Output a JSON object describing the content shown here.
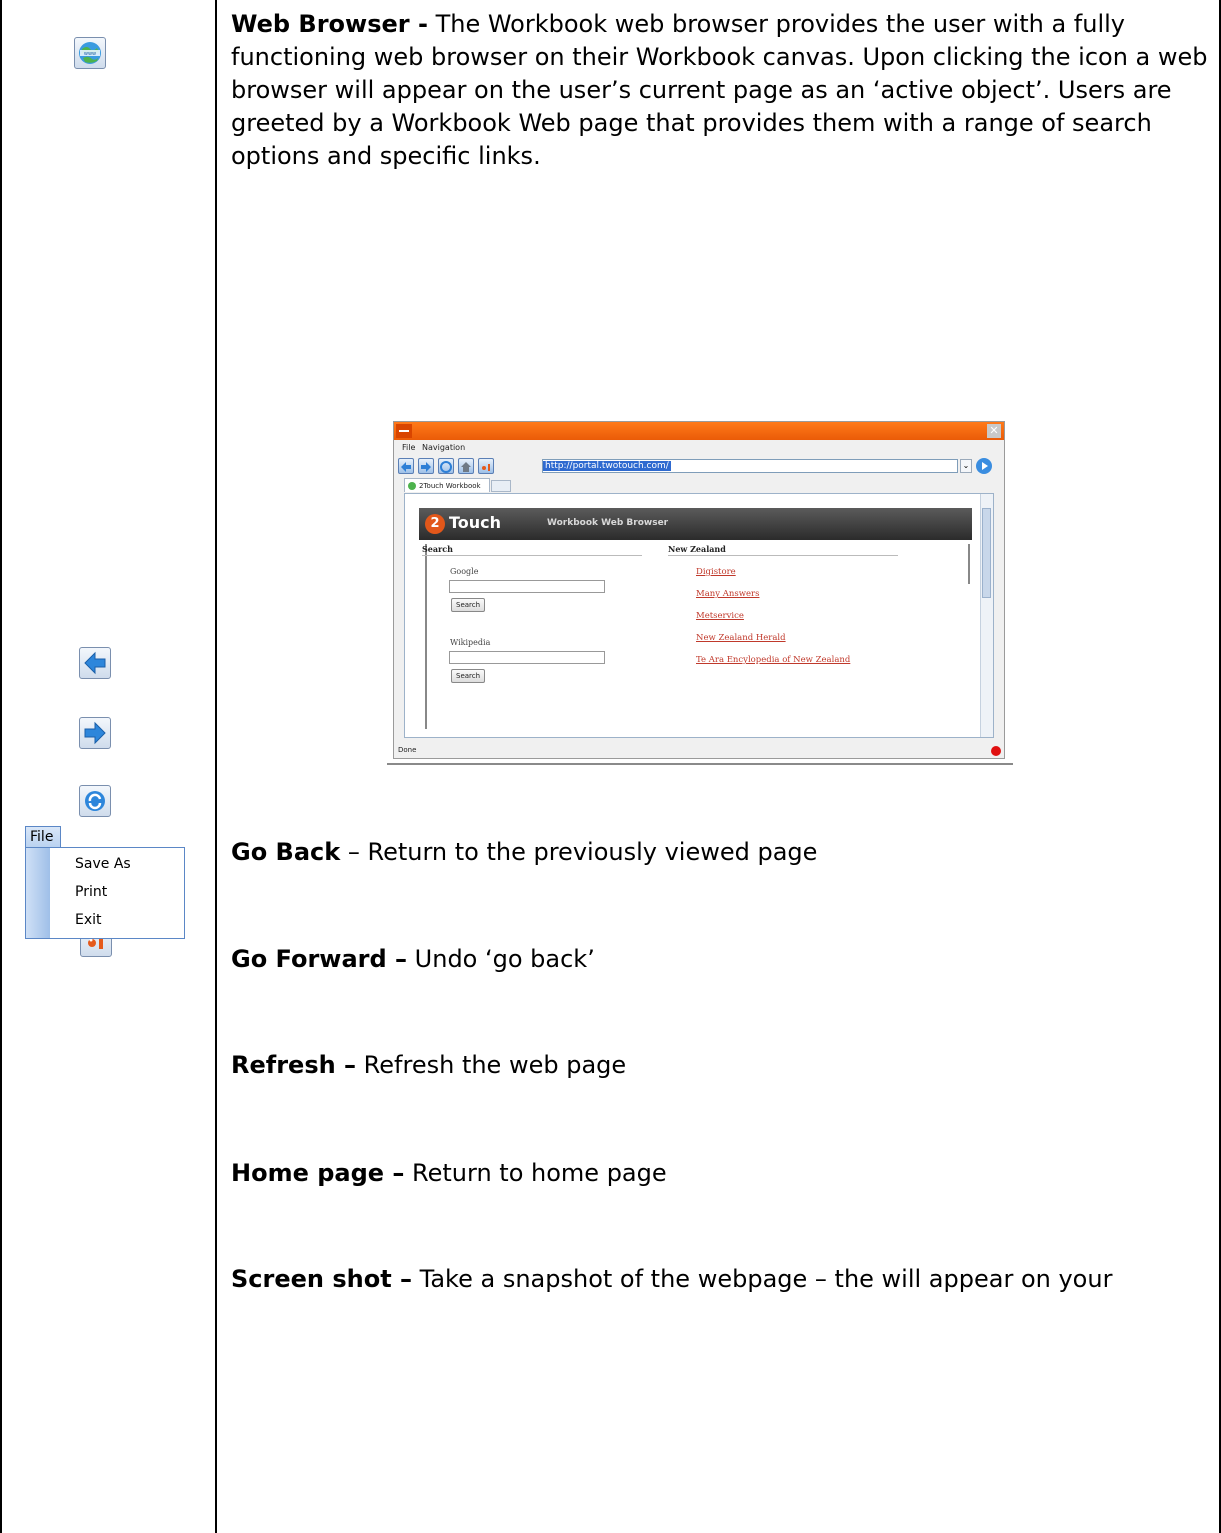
{
  "intro": {
    "title": "Web Browser -",
    "text": " The Workbook web browser provides the user with a fully functioning web browser on their Workbook canvas.  Upon clicking the icon a web browser will appear on the user’s current page as an ‘active object’.  Users are greeted by a Workbook Web page that provides them with a range of search options and specific links."
  },
  "icons": {
    "browser": "www-globe-icon",
    "back": "back-arrow-icon",
    "forward": "forward-arrow-icon",
    "refresh": "refresh-icon",
    "home": "home-icon",
    "screenshot": "screenshot-icon"
  },
  "browser_shot": {
    "menu": [
      "File",
      "Navigation"
    ],
    "url": "http://portal.twotouch.com/",
    "tab_label": "2Touch Workbook Portal",
    "logo_number": "2",
    "logo_text": "Touch",
    "header_title": "Workbook Web Browser",
    "search_heading": "Search",
    "nz_heading": "New Zealand",
    "google_label": "Google",
    "wikipedia_label": "Wikipedia",
    "search_button": "Search",
    "links": [
      "Digistore",
      "Many Answers",
      "Metservice",
      "New Zealand Herald",
      "Te Ara Encylopedia of New Zealand"
    ],
    "status": "Done"
  },
  "file_menu": {
    "tab": "File",
    "items": [
      "Save As",
      "Print",
      "Exit"
    ]
  },
  "descriptions": [
    {
      "term": "Go Back",
      "text": " – Return to the previously viewed page"
    },
    {
      "term": "Go Forward –",
      "text": " Undo ‘go back’"
    },
    {
      "term": "Refresh –",
      "text": " Refresh the web page"
    },
    {
      "term": "Home page –",
      "text": " Return to home page"
    },
    {
      "term": "Screen shot –",
      "text": " Take a snapshot of the webpage – the will appear on your"
    }
  ]
}
